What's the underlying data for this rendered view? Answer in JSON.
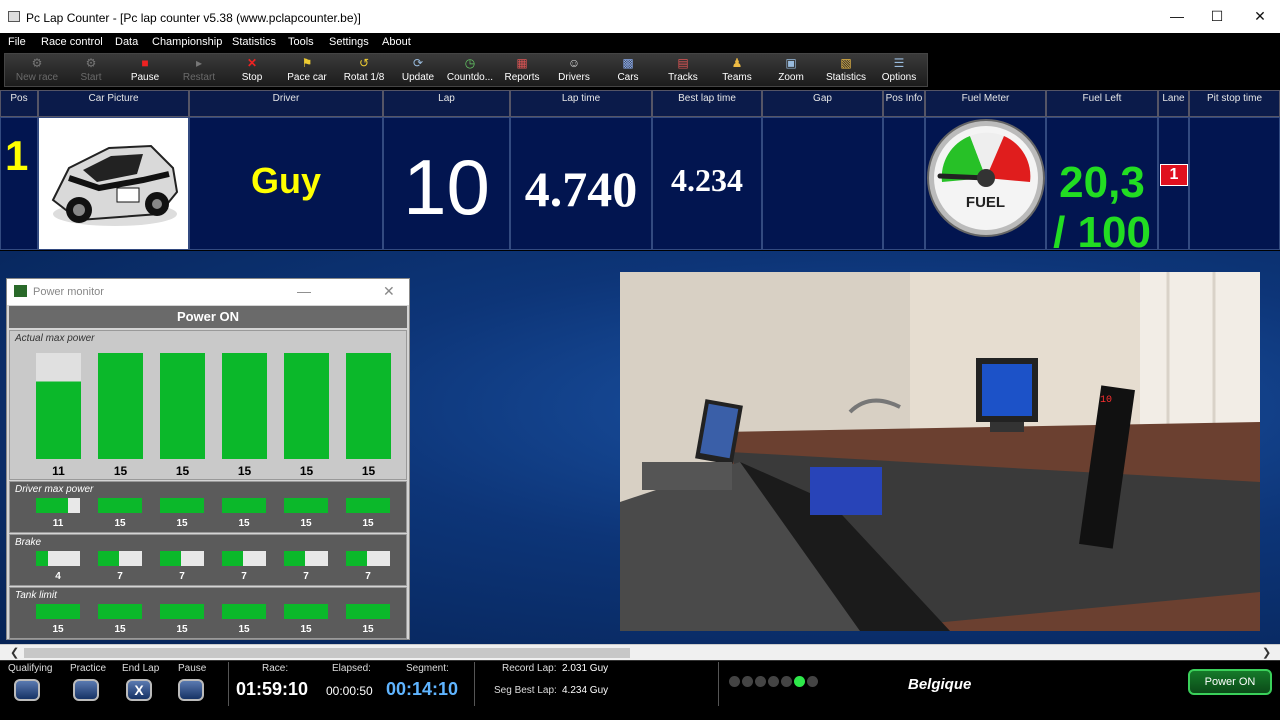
{
  "window": {
    "title": "Pc Lap Counter - [Pc lap counter v5.38 (www.pclapcounter.be)]"
  },
  "menu": [
    "File",
    "Race control",
    "Data",
    "Championship",
    "Statistics",
    "Tools",
    "Settings",
    "About"
  ],
  "toolbar": [
    {
      "label": "New race",
      "icon": "new-race-icon",
      "enabled": false
    },
    {
      "label": "Start",
      "icon": "start-icon",
      "enabled": false
    },
    {
      "label": "Pause",
      "icon": "pause-icon",
      "enabled": true
    },
    {
      "label": "Restart",
      "icon": "restart-icon",
      "enabled": false
    },
    {
      "label": "Stop",
      "icon": "stop-icon",
      "enabled": true
    },
    {
      "label": "Pace car",
      "icon": "pace-car-icon",
      "enabled": true
    },
    {
      "label": "Rotat 1/8",
      "icon": "rotate-icon",
      "enabled": true
    },
    {
      "label": "Update",
      "icon": "update-icon",
      "enabled": true
    },
    {
      "label": "Countdo...",
      "icon": "countdown-icon",
      "enabled": true
    },
    {
      "label": "Reports",
      "icon": "reports-icon",
      "enabled": true
    },
    {
      "label": "Drivers",
      "icon": "drivers-icon",
      "enabled": true
    },
    {
      "label": "Cars",
      "icon": "cars-icon",
      "enabled": true
    },
    {
      "label": "Tracks",
      "icon": "tracks-icon",
      "enabled": true
    },
    {
      "label": "Teams",
      "icon": "teams-icon",
      "enabled": true
    },
    {
      "label": "Zoom",
      "icon": "zoom-icon",
      "enabled": true
    },
    {
      "label": "Statistics",
      "icon": "statistics-icon",
      "enabled": true
    },
    {
      "label": "Options",
      "icon": "options-icon",
      "enabled": true
    }
  ],
  "race_table": {
    "headers": [
      "Pos",
      "Car Picture",
      "Driver",
      "Lap",
      "Lap time",
      "Best lap time",
      "Gap",
      "Pos Info",
      "Fuel Meter",
      "Fuel Left",
      "Lane",
      "Pit stop time"
    ],
    "row": {
      "pos": "1",
      "driver": "Guy",
      "lap": "10",
      "lap_time": "4.740",
      "best_lap_time": "4.234",
      "gap": "",
      "pos_info": "",
      "fuel_gauge_label": "FUEL",
      "fuel_left": "20,3",
      "fuel_total": "/ 100",
      "lane": "1",
      "pit_stop_time": ""
    }
  },
  "power_monitor": {
    "title": "Power monitor",
    "status": "Power ON",
    "actual_label": "Actual max power",
    "actual": [
      11,
      15,
      15,
      15,
      15,
      15
    ],
    "actual_max": 15,
    "driver_label": "Driver max power",
    "driver": [
      11,
      15,
      15,
      15,
      15,
      15
    ],
    "brake_label": "Brake",
    "brake": [
      4,
      7,
      7,
      7,
      7,
      7
    ],
    "brake_max": 15,
    "tank_label": "Tank limit",
    "tank": [
      15,
      15,
      15,
      15,
      15,
      15
    ]
  },
  "status_bar": {
    "qualifying": "Qualifying",
    "practice": "Practice",
    "end_lap": "End Lap",
    "end_lap_mark": "X",
    "pause": "Pause",
    "race_label": "Race:",
    "race_time": "01:59:10",
    "elapsed_label": "Elapsed:",
    "elapsed_time": "00:00:50",
    "segment_label": "Segment:",
    "segment_time": "00:14:10",
    "record_lap_label": "Record Lap:",
    "record_lap_value": "2.031 Guy",
    "seg_best_label": "Seg Best Lap:",
    "seg_best_value": "4.234 Guy",
    "country": "Belgique",
    "power_button": "Power ON"
  },
  "colors": {
    "accent_green": "#0bb82a",
    "fuel_green": "#22dd22",
    "lap_yellow": "#ffff00",
    "row_bg": "#021550"
  }
}
